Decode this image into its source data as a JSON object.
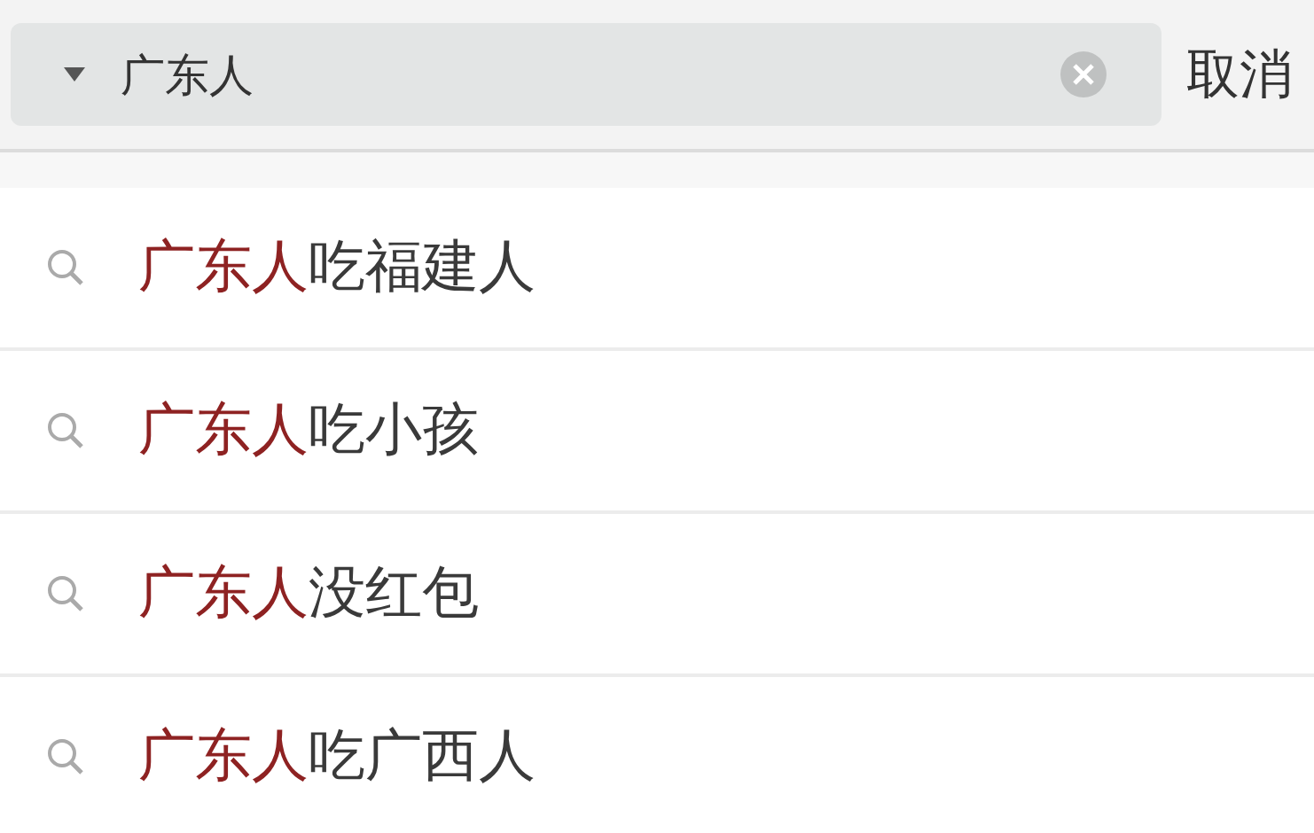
{
  "search": {
    "value": "广东人",
    "cancel": "取消"
  },
  "suggestions": [
    {
      "match": "广东人",
      "rest": "吃福建人"
    },
    {
      "match": "广东人",
      "rest": "吃小孩"
    },
    {
      "match": "广东人",
      "rest": "没红包"
    },
    {
      "match": "广东人",
      "rest": "吃广西人"
    }
  ]
}
